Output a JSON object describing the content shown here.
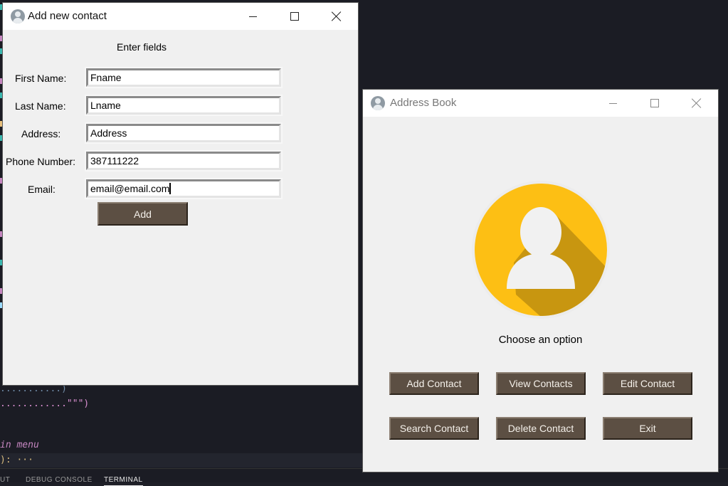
{
  "background_editor": {
    "code_lines": [
      {
        "text": "...........)",
        "color": "#6f8aa6"
      },
      {
        "text": "............\"\"\")",
        "color": "#d98fd0"
      },
      {
        "text": "in menu",
        "color": "#c586c0"
      },
      {
        "text": "): ···",
        "color": "#d7ba7d"
      }
    ],
    "panel_tabs": [
      "UT",
      "DEBUG CONSOLE",
      "TERMINAL"
    ]
  },
  "add_window": {
    "title": "Add new contact",
    "heading": "Enter fields",
    "fields": [
      {
        "label": "First Name:",
        "value": "Fname"
      },
      {
        "label": "Last Name:",
        "value": "Lname"
      },
      {
        "label": "Address:",
        "value": "Address"
      },
      {
        "label": "Phone Number:",
        "value": "387111222"
      },
      {
        "label": "Email:",
        "value": "email@email.com"
      }
    ],
    "add_button": "Add"
  },
  "main_window": {
    "title": "Address Book",
    "prompt": "Choose an option",
    "buttons": [
      "Add Contact",
      "View Contacts",
      "Edit Contact",
      "Search Contact",
      "Delete Contact",
      "Exit"
    ],
    "avatar_color": "#fdbf14"
  },
  "icons": {
    "app_icon": "user-avatar-icon",
    "minimize": "minimize-icon",
    "maximize": "maximize-icon",
    "close": "close-icon"
  }
}
